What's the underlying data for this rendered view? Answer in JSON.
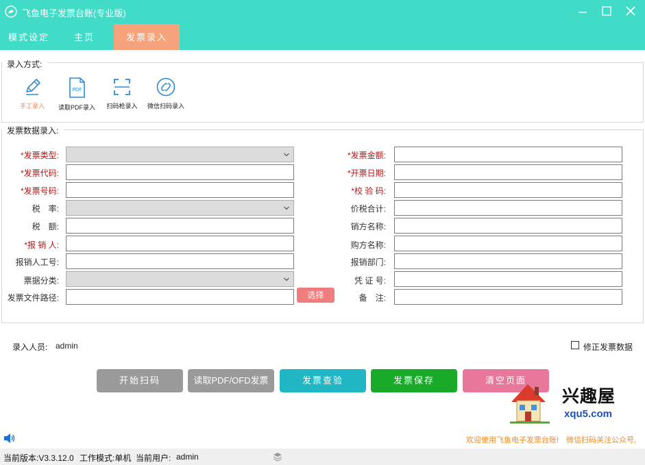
{
  "window": {
    "title": "飞鱼电子发票台账(专业版)"
  },
  "menu": {
    "tabs": [
      "模式设定",
      "主页",
      "发票录入"
    ]
  },
  "input_method": {
    "title": "录入方式:",
    "items": [
      {
        "label": "手工录入",
        "icon": "pencil-icon"
      },
      {
        "label": "读取PDF录入",
        "icon": "pdf-file-icon"
      },
      {
        "label": "扫码枪录入",
        "icon": "scan-frame-icon"
      },
      {
        "label": "微信扫码录入",
        "icon": "link-circle-icon"
      }
    ]
  },
  "form": {
    "title": "发票数据录入:",
    "left": [
      {
        "label": "*发票类型:",
        "type": "select"
      },
      {
        "label": "*发票代码:",
        "type": "input"
      },
      {
        "label": "*发票号码:",
        "type": "input"
      },
      {
        "label": "税　率:",
        "type": "select"
      },
      {
        "label": "税　额:",
        "type": "input"
      },
      {
        "label": "*报 销 人:",
        "type": "input"
      },
      {
        "label": "报销人工号:",
        "type": "input"
      },
      {
        "label": "票据分类:",
        "type": "select"
      },
      {
        "label": "发票文件路径:",
        "type": "input"
      }
    ],
    "right": [
      {
        "label": "*发票金额:"
      },
      {
        "label": "*开票日期:"
      },
      {
        "label": "*校 验 码:"
      },
      {
        "label": "价税合计:"
      },
      {
        "label": "销方名称:"
      },
      {
        "label": "购方名称:"
      },
      {
        "label": "报销部门:"
      },
      {
        "label": "凭 证 号:"
      },
      {
        "label": "备　注:"
      }
    ],
    "pick_button": "选择"
  },
  "entry_person": {
    "label": "录入人员:",
    "value": "admin"
  },
  "fix_data": {
    "label": "修正发票数据",
    "checked": false
  },
  "actions": [
    "开始扫码",
    "读取PDF/OFD发票",
    "发票查验",
    "发票保存",
    "清空页面"
  ],
  "watermark": {
    "text": "兴趣屋",
    "url": "xqu5.com"
  },
  "marquee": "欢迎使用飞鱼电子发票台账!　微信扫码关注公众号,",
  "status": {
    "version": "当前版本:V3.3.12.0",
    "mode": "工作模式:单机",
    "user_label": "当前用户:",
    "user": "admin"
  },
  "colors": {
    "accent": "#40dcc8",
    "active_tab": "#f6a27a",
    "required": "#b01919"
  }
}
